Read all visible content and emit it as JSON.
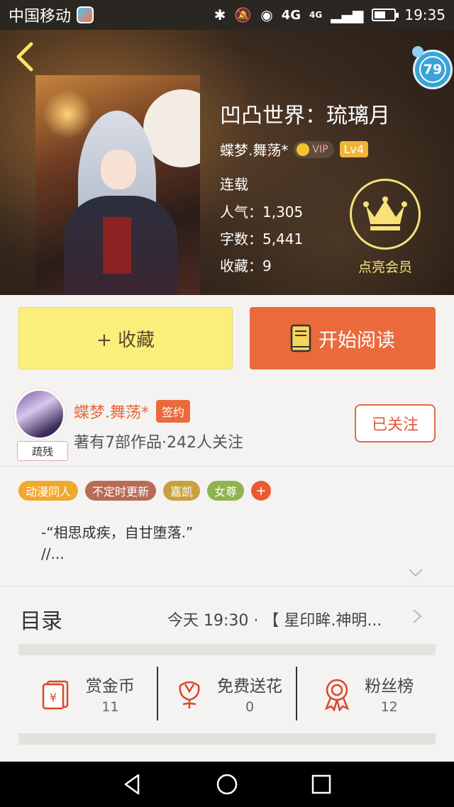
{
  "statusbar": {
    "carrier": "中国移动",
    "network": "4G",
    "network_small": "4G",
    "time": "19:35",
    "battery_level": 0.55
  },
  "header": {
    "badge_count": "79"
  },
  "book": {
    "title": "凹凸世界：琉璃月",
    "author": "蝶梦.舞荡*",
    "vip_label": "VIP",
    "level": "Lv4",
    "status": "连载",
    "popularity_label": "人气：",
    "popularity": "1,305",
    "words_label": "字数：",
    "words": "5,441",
    "favorites_label": "收藏：",
    "favorites": "9"
  },
  "member": {
    "label": "点亮会员"
  },
  "actions": {
    "collect": "+ 收藏",
    "read": "开始阅读"
  },
  "author_card": {
    "name": "蝶梦.舞荡*",
    "signed": "签约",
    "stats": "著有7部作品·242人关注",
    "avatar_tag": "疏残",
    "follow": "已关注"
  },
  "tags": [
    {
      "label": "动漫同人",
      "color": "#f0a830"
    },
    {
      "label": "不定时更新",
      "color": "#b86c58"
    },
    {
      "label": "嘉凯",
      "color": "#c9a13c"
    },
    {
      "label": "女尊",
      "color": "#8fb34e"
    }
  ],
  "tag_more": "+",
  "description": {
    "line1": "-“相思成疾，自甘堕落.”",
    "line2": "//..."
  },
  "toc": {
    "label": "目录",
    "latest": "今天 19:30 · 【 星印眸.神明..."
  },
  "stats": [
    {
      "label": "赏金币",
      "value": "11",
      "icon": "red-envelope-icon"
    },
    {
      "label": "免费送花",
      "value": "0",
      "icon": "flower-icon"
    },
    {
      "label": "粉丝榜",
      "value": "12",
      "icon": "medal-icon"
    }
  ],
  "colors": {
    "accent": "#ea6a3c",
    "collect_bg": "#fbef7c",
    "icon_red": "#d9472b"
  }
}
